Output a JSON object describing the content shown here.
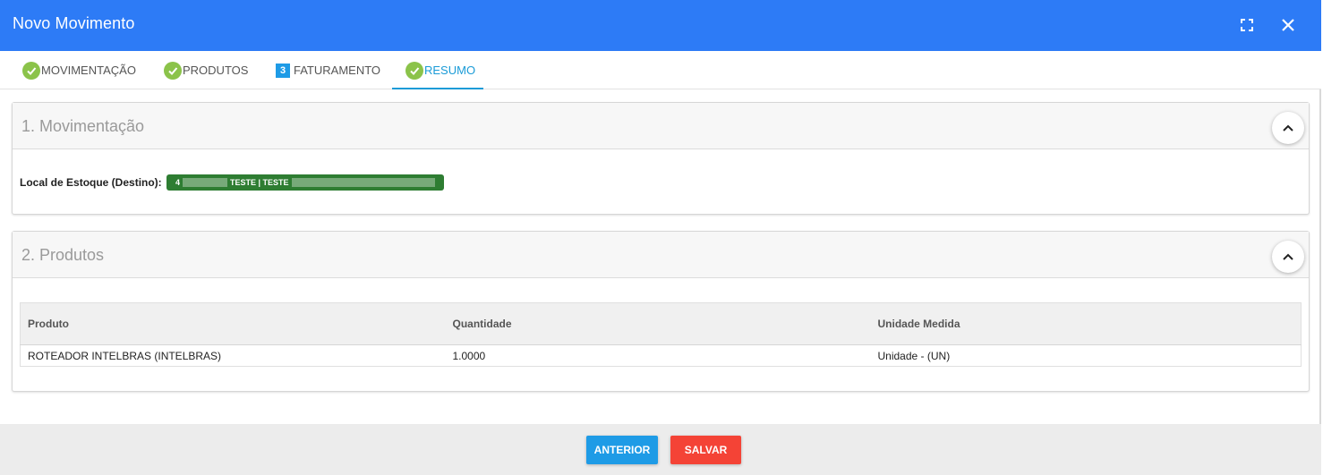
{
  "header": {
    "title": "Novo Movimento",
    "expand_icon": "fullscreen-icon",
    "close_icon": "close-icon"
  },
  "tabs": [
    {
      "label": "MOVIMENTAÇÃO",
      "status": "done"
    },
    {
      "label": "PRODUTOS",
      "status": "done"
    },
    {
      "label": "FATURAMENTO",
      "status": "step",
      "number": "3"
    },
    {
      "label": "RESUMO",
      "status": "done",
      "active": true
    }
  ],
  "movimentacao": {
    "title": "1. Movimentação",
    "stock_label": "Local de Estoque (Destino):",
    "stock_value_prefix": "4",
    "stock_value": "TESTE | TESTE"
  },
  "produtos": {
    "title": "2. Produtos",
    "columns": [
      "Produto",
      "Quantidade",
      "Unidade Medida"
    ],
    "rows": [
      [
        "ROTEADOR INTELBRAS (INTELBRAS)",
        "1.0000",
        "Unidade - (UN)"
      ]
    ]
  },
  "footer": {
    "prev_label": "ANTERIOR",
    "save_label": "SALVAR"
  },
  "colors": {
    "header": "#2d7bf6",
    "active_tab": "#1a9bd7",
    "check": "#8bc34a",
    "badge": "#2e7d32",
    "prev_button": "#1e9be6",
    "save_button": "#f44336"
  }
}
